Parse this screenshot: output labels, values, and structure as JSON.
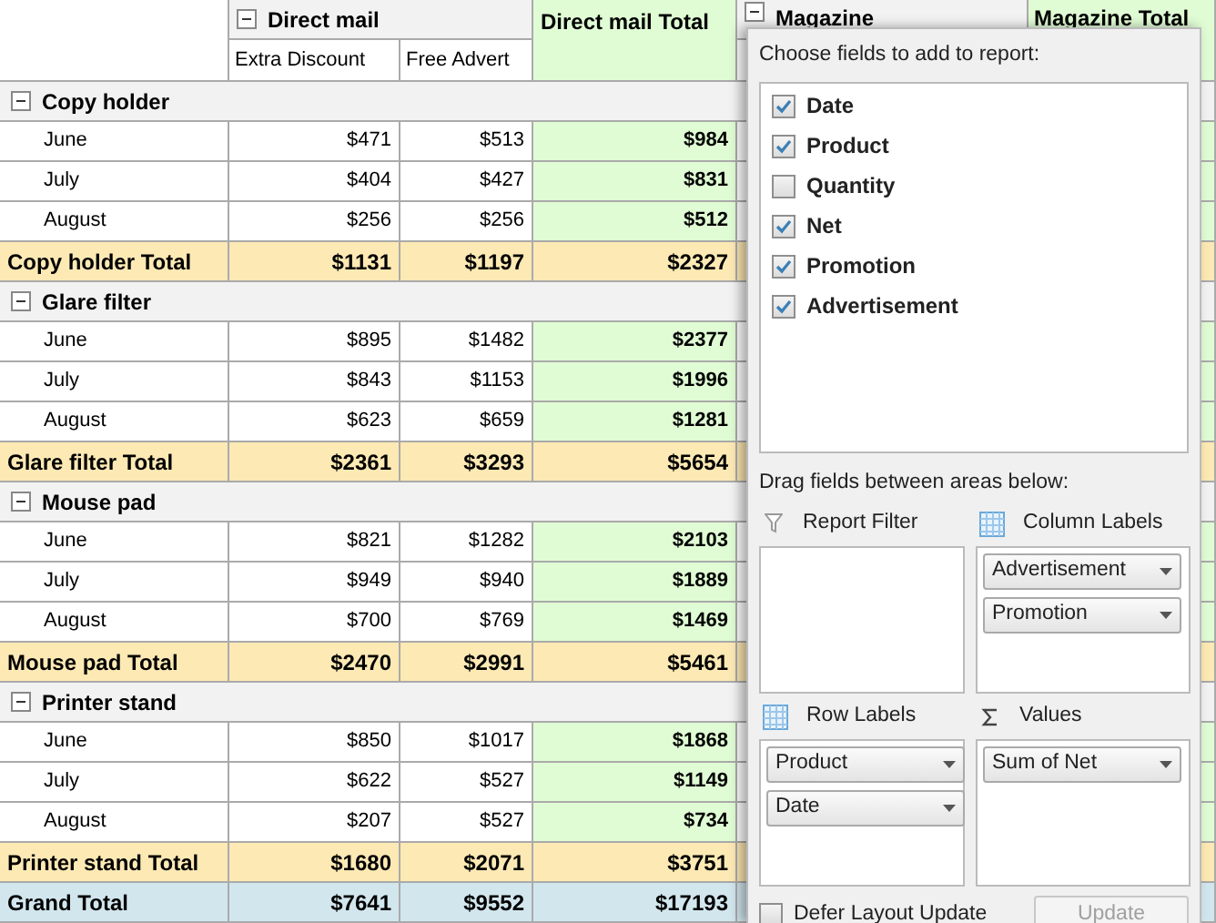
{
  "columns": {
    "group": {
      "label": "Direct mail",
      "expanded": true,
      "subcolumns": [
        "Extra Discount",
        "Free Advert"
      ]
    },
    "group_total": "Direct mail Total",
    "next_group": {
      "label": "Magazine",
      "expanded": true
    },
    "next_group_total": "Magazine Total"
  },
  "groups": [
    {
      "label": "Copy holder",
      "expanded": true,
      "rows": [
        {
          "label": "June",
          "values": [
            "$471",
            "$513",
            "$984"
          ]
        },
        {
          "label": "July",
          "values": [
            "$404",
            "$427",
            "$831"
          ]
        },
        {
          "label": "August",
          "values": [
            "$256",
            "$256",
            "$512"
          ]
        }
      ],
      "total": {
        "label": "Copy holder Total",
        "values": [
          "$1131",
          "$1197",
          "$2327"
        ]
      }
    },
    {
      "label": "Glare filter",
      "expanded": true,
      "rows": [
        {
          "label": "June",
          "values": [
            "$895",
            "$1482",
            "$2377"
          ]
        },
        {
          "label": "July",
          "values": [
            "$843",
            "$1153",
            "$1996"
          ]
        },
        {
          "label": "August",
          "values": [
            "$623",
            "$659",
            "$1281"
          ]
        }
      ],
      "total": {
        "label": "Glare filter Total",
        "values": [
          "$2361",
          "$3293",
          "$5654"
        ]
      }
    },
    {
      "label": "Mouse pad",
      "expanded": true,
      "rows": [
        {
          "label": "June",
          "values": [
            "$821",
            "$1282",
            "$2103"
          ]
        },
        {
          "label": "July",
          "values": [
            "$949",
            "$940",
            "$1889"
          ]
        },
        {
          "label": "August",
          "values": [
            "$700",
            "$769",
            "$1469"
          ]
        }
      ],
      "total": {
        "label": "Mouse pad Total",
        "values": [
          "$2470",
          "$2991",
          "$5461"
        ]
      }
    },
    {
      "label": "Printer stand",
      "expanded": true,
      "rows": [
        {
          "label": "June",
          "values": [
            "$850",
            "$1017",
            "$1868"
          ]
        },
        {
          "label": "July",
          "values": [
            "$622",
            "$527",
            "$1149"
          ]
        },
        {
          "label": "August",
          "values": [
            "$207",
            "$527",
            "$734"
          ]
        }
      ],
      "total": {
        "label": "Printer stand Total",
        "values": [
          "$1680",
          "$2071",
          "$3751"
        ]
      }
    }
  ],
  "grand_total": {
    "label": "Grand Total",
    "values": [
      "$7641",
      "$9552",
      "$17193"
    ]
  },
  "field_list": {
    "title": "Choose fields to add to report:",
    "fields": [
      {
        "label": "Date",
        "checked": true
      },
      {
        "label": "Product",
        "checked": true
      },
      {
        "label": "Quantity",
        "checked": false
      },
      {
        "label": "Net",
        "checked": true
      },
      {
        "label": "Promotion",
        "checked": true
      },
      {
        "label": "Advertisement",
        "checked": true
      }
    ],
    "drag_hint": "Drag fields between areas below:",
    "areas": [
      {
        "kind": "filter",
        "label": "Report Filter"
      },
      {
        "kind": "columns",
        "label": "Column Labels",
        "items": [
          "Advertisement",
          "Promotion"
        ]
      },
      {
        "kind": "rows",
        "label": "Row Labels",
        "items": [
          "Product",
          "Date"
        ]
      },
      {
        "kind": "values",
        "label": "Values",
        "items": [
          "Sum of Net"
        ]
      }
    ],
    "defer": {
      "label": "Defer Layout Update",
      "checked": false
    },
    "update_button": {
      "label": "Update",
      "disabled": true
    }
  }
}
